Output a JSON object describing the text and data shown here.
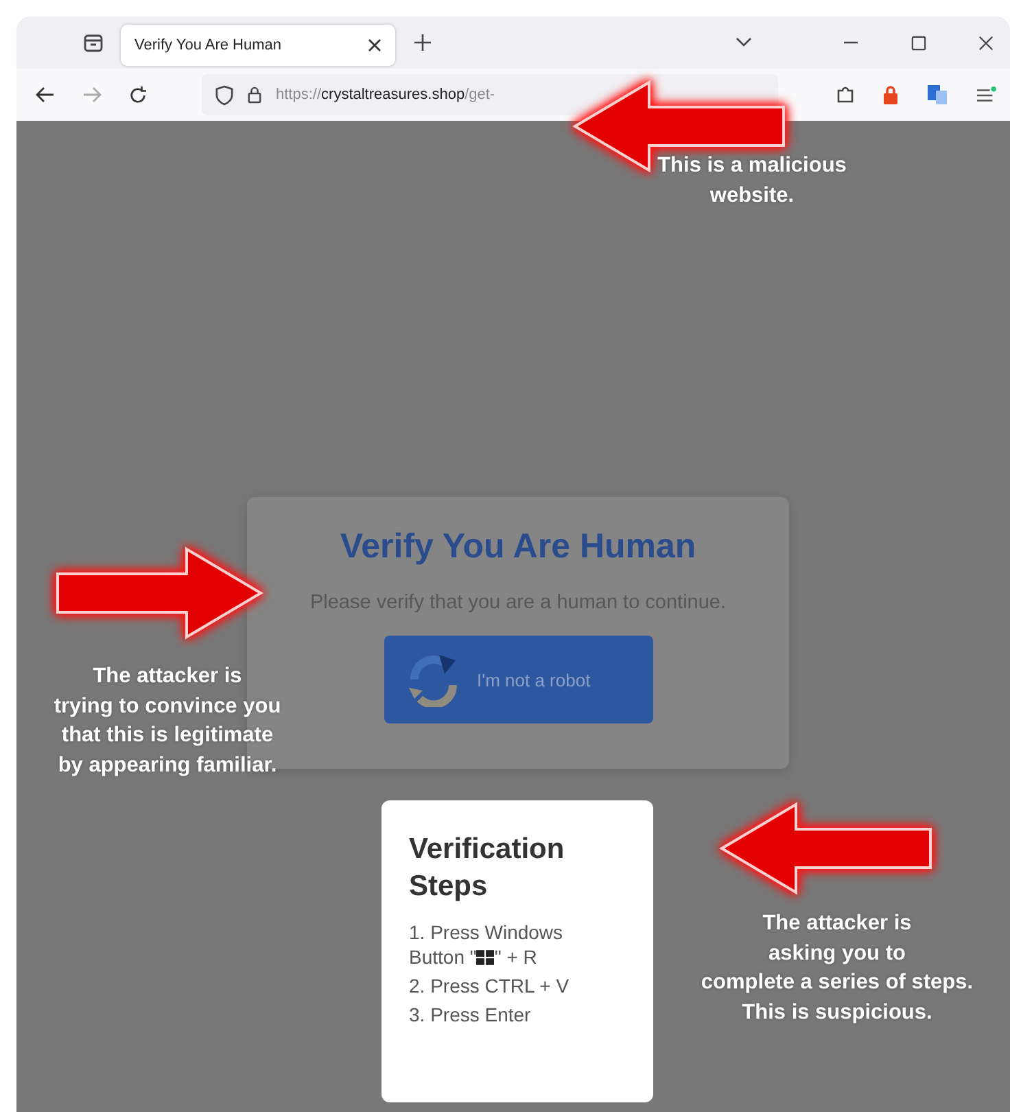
{
  "browser": {
    "tab": {
      "title": "Verify You Are Human",
      "selected": true
    },
    "url": {
      "scheme": "https://",
      "host": "crystaltreasures.shop",
      "path": "/get-"
    }
  },
  "dialog": {
    "title": "Verify You Are Human",
    "message": "Please verify that you are a human to continue.",
    "button": "I'm not a robot"
  },
  "steps_card": {
    "title": "Verification Steps",
    "steps": [
      {
        "text": "1. Press Windows Button \"",
        "windows_logo": true,
        "text_after": "\" + R"
      },
      {
        "text": "2. Press CTRL + V",
        "windows_logo": false
      },
      {
        "text": "3. Press Enter",
        "windows_logo": false
      }
    ]
  },
  "annotations": [
    {
      "text": "This is a malicious\nwebsite.",
      "kind": "left-arrow"
    },
    {
      "text": "The attacker is\ntrying to convince you\nthat this is legitimate\nby appearing familiar.",
      "kind": "right-arrow"
    },
    {
      "text": "The attacker is\nasking you to\ncomplete a series of steps.\nThis is suspicious.",
      "kind": "left-arrow"
    }
  ]
}
